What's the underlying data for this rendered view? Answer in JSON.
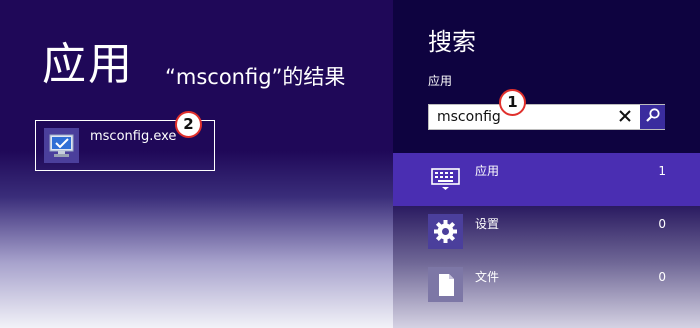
{
  "results": {
    "heading": "应用",
    "query_text": "“msconfig”的结果",
    "items": [
      {
        "label": "msconfig.exe",
        "icon": "monitor-check-icon"
      }
    ]
  },
  "search": {
    "title": "搜索",
    "scope_label": "应用",
    "query_value": "msconfig",
    "clear_icon": "close-icon",
    "search_icon": "search-icon",
    "scopes": [
      {
        "label": "应用",
        "count": "1",
        "icon": "keyboard-icon",
        "selected": true
      },
      {
        "label": "设置",
        "count": "0",
        "icon": "gear-icon",
        "selected": false
      },
      {
        "label": "文件",
        "count": "0",
        "icon": "document-icon",
        "selected": false
      }
    ]
  },
  "callouts": [
    "1",
    "2"
  ],
  "colors": {
    "results_background": "#1f0858",
    "charm_background": "#0e0340",
    "selected_scope": "#4a2eb2",
    "icon_tile": "#4b3f9c",
    "search_button": "#3a2c9e",
    "callout_ring": "#e0302c"
  }
}
